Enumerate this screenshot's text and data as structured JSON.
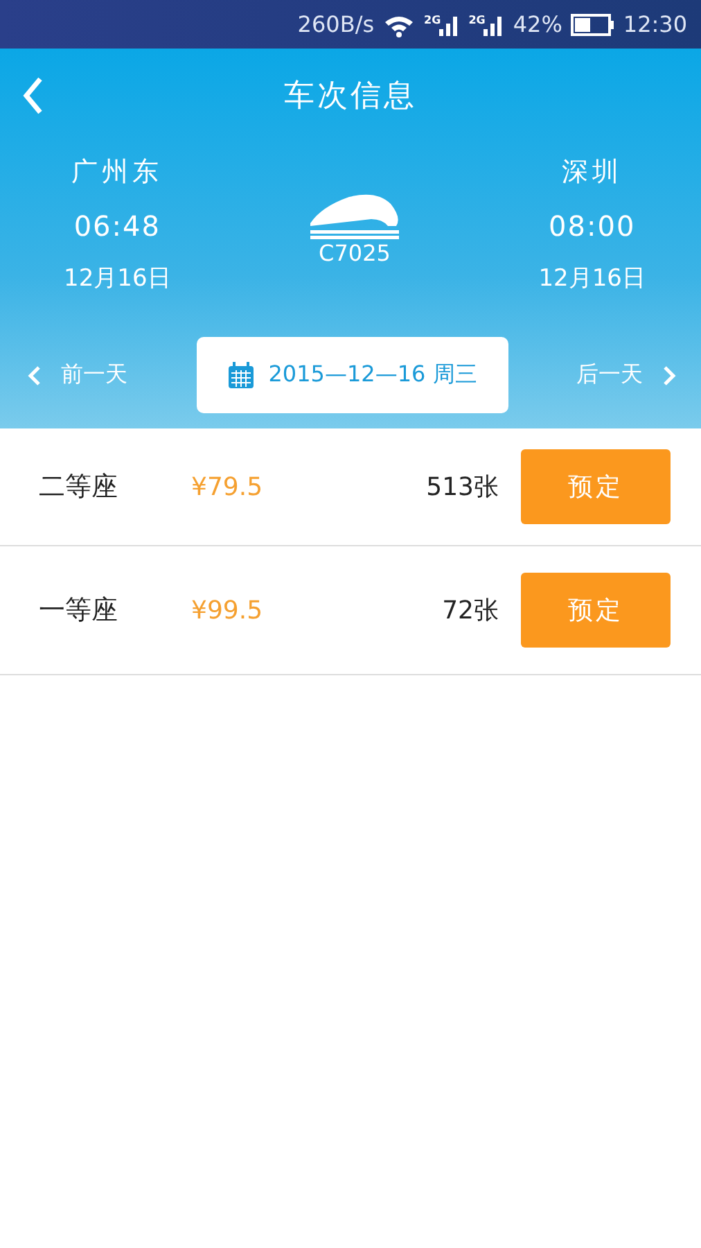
{
  "status_bar": {
    "speed": "260B/s",
    "signals": [
      {
        "label": "2G"
      },
      {
        "label": "2G"
      }
    ],
    "battery": "42%",
    "time": "12:30"
  },
  "header": {
    "title": "车次信息"
  },
  "trip": {
    "from": {
      "station": "广州东",
      "time": "06:48",
      "date": "12月16日"
    },
    "train": "C7025",
    "to": {
      "station": "深圳",
      "time": "08:00",
      "date": "12月16日"
    }
  },
  "date_nav": {
    "prev": "前一天",
    "date": "2015—12—16 周三",
    "next": "后一天"
  },
  "seats": [
    {
      "name": "二等座",
      "price": "¥79.5",
      "count": "513张",
      "button": "预定"
    },
    {
      "name": "一等座",
      "price": "¥99.5",
      "count": "72张",
      "button": "预定"
    }
  ]
}
